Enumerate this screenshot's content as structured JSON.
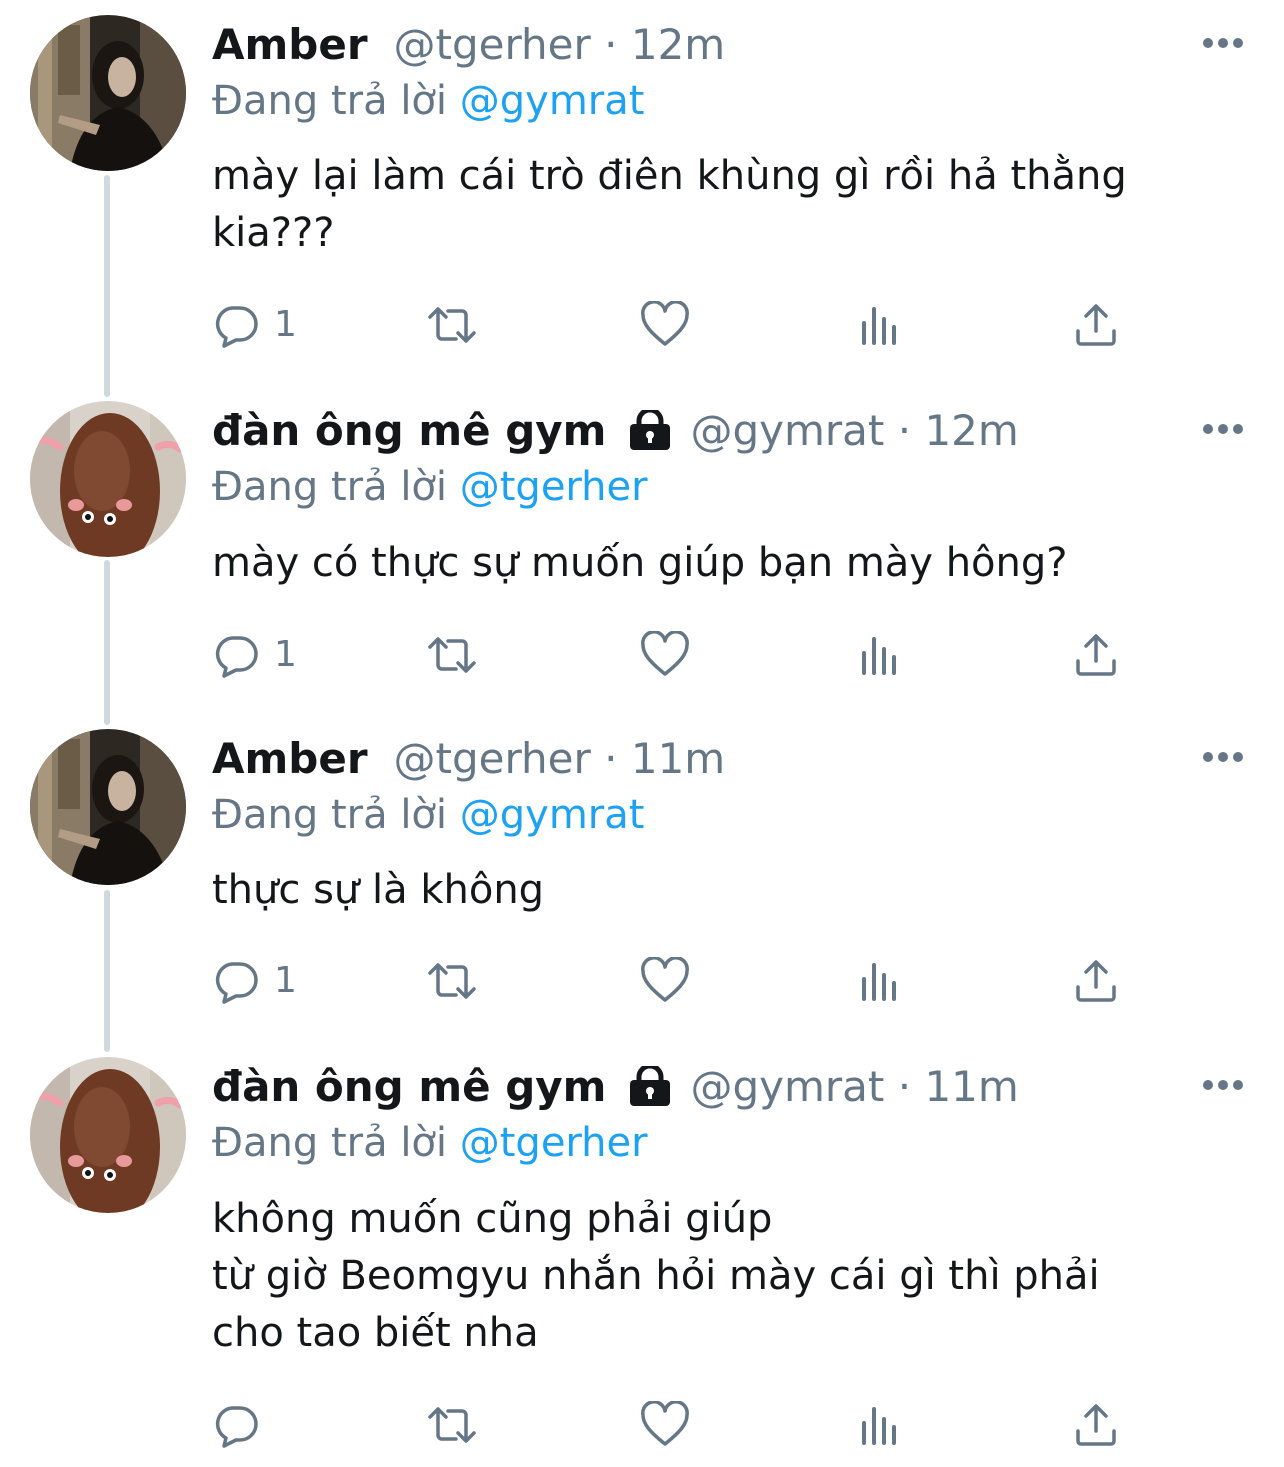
{
  "tweets": [
    {
      "name": "Amber",
      "handle": "@tgerher",
      "time": "12m",
      "locked": false,
      "avatar": "amber-photo",
      "reply_prefix": "Đang trả lời",
      "reply_to": "@gymrat",
      "lines": [
        "mày lại làm cái trò điên khùng gì rồi hả thằng",
        "kia???"
      ],
      "reply_count": "1"
    },
    {
      "name": "đàn ông mê gym",
      "handle": "@gymrat",
      "time": "12m",
      "locked": true,
      "avatar": "brown-figure-photo",
      "reply_prefix": "Đang trả lời",
      "reply_to": "@tgerher",
      "lines": [
        "mày có thực sự muốn giúp bạn mày hông?"
      ],
      "reply_count": "1"
    },
    {
      "name": "Amber",
      "handle": "@tgerher",
      "time": "11m",
      "locked": false,
      "avatar": "amber-photo",
      "reply_prefix": "Đang trả lời",
      "reply_to": "@gymrat",
      "lines": [
        "thực sự là không"
      ],
      "reply_count": "1"
    },
    {
      "name": "đàn ông mê gym",
      "handle": "@gymrat",
      "time": "11m",
      "locked": true,
      "avatar": "brown-figure-photo",
      "reply_prefix": "Đang trả lời",
      "reply_to": "@tgerher",
      "lines": [
        "không muốn cũng phải giúp",
        "từ giờ Beomgyu nhắn hỏi mày cái gì thì phải",
        "cho tao biết nha"
      ],
      "reply_count": ""
    }
  ],
  "separator": "·",
  "icons": {
    "reply": "reply-icon",
    "retweet": "retweet-icon",
    "like": "heart-icon",
    "analytics": "analytics-icon",
    "share": "share-icon",
    "more": "more-icon",
    "lock": "lock-icon"
  },
  "colors": {
    "text": "#14171a",
    "secondary": "#657786",
    "link": "#1da1f2",
    "thread_line": "#cfd9de"
  }
}
